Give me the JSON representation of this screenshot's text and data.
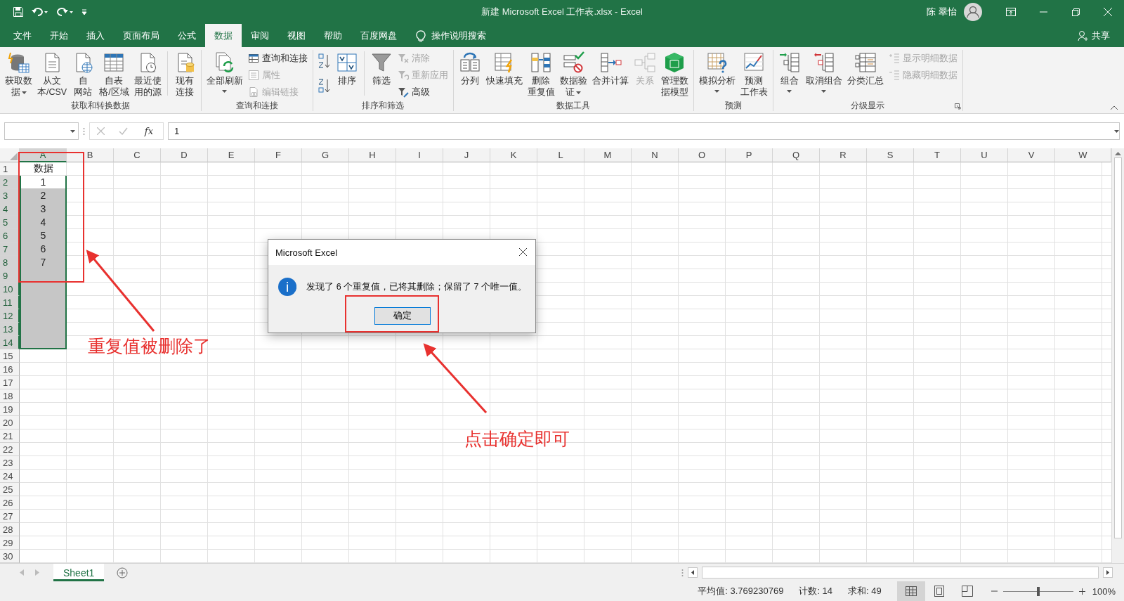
{
  "window": {
    "title": "新建 Microsoft Excel 工作表.xlsx  -  Excel",
    "user": "陈 翠怡"
  },
  "tabs": [
    {
      "label": "文件",
      "selected": false
    },
    {
      "label": "开始",
      "selected": false
    },
    {
      "label": "插入",
      "selected": false
    },
    {
      "label": "页面布局",
      "selected": false
    },
    {
      "label": "公式",
      "selected": false
    },
    {
      "label": "数据",
      "selected": true
    },
    {
      "label": "审阅",
      "selected": false
    },
    {
      "label": "视图",
      "selected": false
    },
    {
      "label": "帮助",
      "selected": false
    },
    {
      "label": "百度网盘",
      "selected": false
    }
  ],
  "tell_me": "操作说明搜索",
  "share": "共享",
  "ribbon_groups": [
    {
      "label": "获取和转换数据",
      "items": [
        {
          "kind": "large",
          "lines": [
            "获取数",
            "据"
          ],
          "dropdown": true,
          "disabled": false
        },
        {
          "kind": "large",
          "lines": [
            "从文",
            "本/CSV"
          ],
          "dropdown": false,
          "disabled": false
        },
        {
          "kind": "large",
          "lines": [
            "自",
            "网站"
          ],
          "dropdown": false,
          "disabled": false
        },
        {
          "kind": "large",
          "lines": [
            "自表",
            "格/区域"
          ],
          "dropdown": false,
          "disabled": false
        },
        {
          "kind": "large",
          "lines": [
            "最近使",
            "用的源"
          ],
          "dropdown": false,
          "disabled": false
        },
        {
          "kind": "separator"
        },
        {
          "kind": "large",
          "lines": [
            "现有",
            "连接"
          ],
          "dropdown": false,
          "disabled": false
        }
      ]
    },
    {
      "label": "查询和连接",
      "items": [
        {
          "kind": "large",
          "lines": [
            "全部刷新"
          ],
          "dropdown": true,
          "disabled": false
        },
        {
          "kind": "small",
          "label": "查询和连接",
          "disabled": false
        },
        {
          "kind": "small",
          "label": "属性",
          "disabled": true
        },
        {
          "kind": "small",
          "label": "编辑链接",
          "disabled": true
        }
      ]
    },
    {
      "label": "排序和筛选",
      "items": [
        {
          "kind": "sort_pair"
        },
        {
          "kind": "large",
          "lines": [
            "排序"
          ],
          "dropdown": false,
          "disabled": false
        },
        {
          "kind": "separator"
        },
        {
          "kind": "large",
          "lines": [
            "筛选"
          ],
          "dropdown": false,
          "disabled": false
        },
        {
          "kind": "small",
          "label": "清除",
          "disabled": true
        },
        {
          "kind": "small",
          "label": "重新应用",
          "disabled": true
        },
        {
          "kind": "small",
          "label": "高级",
          "disabled": false
        }
      ]
    },
    {
      "label": "数据工具",
      "items": [
        {
          "kind": "large",
          "lines": [
            "分列"
          ],
          "dropdown": false,
          "disabled": false
        },
        {
          "kind": "large",
          "lines": [
            "快速填充"
          ],
          "dropdown": false,
          "disabled": false
        },
        {
          "kind": "large",
          "lines": [
            "删除",
            "重复值"
          ],
          "dropdown": false,
          "disabled": false
        },
        {
          "kind": "large",
          "lines": [
            "数据验",
            "证"
          ],
          "dropdown": true,
          "disabled": false
        },
        {
          "kind": "large",
          "lines": [
            "合并计算"
          ],
          "dropdown": false,
          "disabled": false
        },
        {
          "kind": "large",
          "lines": [
            "关系"
          ],
          "dropdown": false,
          "disabled": true
        },
        {
          "kind": "large",
          "lines": [
            "管理数",
            "据模型"
          ],
          "dropdown": false,
          "disabled": false
        }
      ]
    },
    {
      "label": "预测",
      "items": [
        {
          "kind": "large",
          "lines": [
            "模拟分析"
          ],
          "dropdown": true,
          "disabled": false
        },
        {
          "kind": "large",
          "lines": [
            "预测",
            "工作表"
          ],
          "dropdown": false,
          "disabled": false
        }
      ]
    },
    {
      "label": "分级显示",
      "items": [
        {
          "kind": "large",
          "lines": [
            "组合"
          ],
          "dropdown": true,
          "disabled": false
        },
        {
          "kind": "large",
          "lines": [
            "取消组合"
          ],
          "dropdown": true,
          "disabled": false
        },
        {
          "kind": "large",
          "lines": [
            "分类汇总"
          ],
          "dropdown": false,
          "disabled": false
        },
        {
          "kind": "small",
          "label": "显示明细数据",
          "disabled": true
        },
        {
          "kind": "small",
          "label": "隐藏明细数据",
          "disabled": true
        }
      ]
    }
  ],
  "formula_bar": {
    "function_label": "fx",
    "value": "1"
  },
  "sheet": {
    "columns": [
      {
        "label": "A",
        "selected": true
      },
      {
        "label": "B",
        "selected": false
      },
      {
        "label": "C",
        "selected": false
      },
      {
        "label": "D",
        "selected": false
      },
      {
        "label": "E",
        "selected": false
      },
      {
        "label": "F",
        "selected": false
      },
      {
        "label": "G",
        "selected": false
      },
      {
        "label": "H",
        "selected": false
      },
      {
        "label": "I",
        "selected": false
      },
      {
        "label": "J",
        "selected": false
      },
      {
        "label": "K",
        "selected": false
      },
      {
        "label": "L",
        "selected": false
      },
      {
        "label": "M",
        "selected": false
      },
      {
        "label": "N",
        "selected": false
      },
      {
        "label": "O",
        "selected": false
      },
      {
        "label": "P",
        "selected": false
      },
      {
        "label": "Q",
        "selected": false
      },
      {
        "label": "R",
        "selected": false
      },
      {
        "label": "S",
        "selected": false
      },
      {
        "label": "T",
        "selected": false
      },
      {
        "label": "U",
        "selected": false
      },
      {
        "label": "V",
        "selected": false
      },
      {
        "label": "W",
        "selected": false
      }
    ],
    "rows": [
      {
        "header": "1",
        "value": "数据",
        "selected": false
      },
      {
        "header": "2",
        "value": "1",
        "selected": true
      },
      {
        "header": "3",
        "value": "2",
        "selected": true
      },
      {
        "header": "4",
        "value": "3",
        "selected": true
      },
      {
        "header": "5",
        "value": "4",
        "selected": true
      },
      {
        "header": "6",
        "value": "5",
        "selected": true
      },
      {
        "header": "7",
        "value": "6",
        "selected": true
      },
      {
        "header": "8",
        "value": "7",
        "selected": true
      },
      {
        "header": "9",
        "selected": true
      },
      {
        "header": "10",
        "selected": true
      },
      {
        "header": "11",
        "selected": true
      },
      {
        "header": "12",
        "selected": true
      },
      {
        "header": "13",
        "selected": true
      },
      {
        "header": "14",
        "selected": true
      },
      {
        "header": "15",
        "selected": false
      },
      {
        "header": "16",
        "selected": false
      },
      {
        "header": "17",
        "selected": false
      },
      {
        "header": "18",
        "selected": false
      },
      {
        "header": "19",
        "selected": false
      },
      {
        "header": "20",
        "selected": false
      },
      {
        "header": "21",
        "selected": false
      },
      {
        "header": "22",
        "selected": false
      },
      {
        "header": "23",
        "selected": false
      },
      {
        "header": "24",
        "selected": false
      },
      {
        "header": "25",
        "selected": false
      },
      {
        "header": "26",
        "selected": false
      },
      {
        "header": "27",
        "selected": false
      },
      {
        "header": "28",
        "selected": false
      },
      {
        "header": "29",
        "selected": false
      },
      {
        "header": "30",
        "selected": false
      }
    ]
  },
  "sheet_tabs": [
    {
      "label": "Sheet1",
      "selected": true
    }
  ],
  "dialog": {
    "title": "Microsoft Excel",
    "message": "发现了 6 个重复值，已将其删除；保留了 7 个唯一值。",
    "button": "确定"
  },
  "status_bar": {
    "stats": [
      "平均值: 3.769230769",
      "计数: 14",
      "求和: 49"
    ],
    "views": [
      {
        "selected": true
      },
      {
        "selected": false
      },
      {
        "selected": false
      }
    ],
    "zoom": {
      "level": 0.5,
      "reading": "100%"
    }
  },
  "annotations": [
    {
      "text": "重复值被删除了"
    },
    {
      "text": "点击确定即可"
    }
  ]
}
